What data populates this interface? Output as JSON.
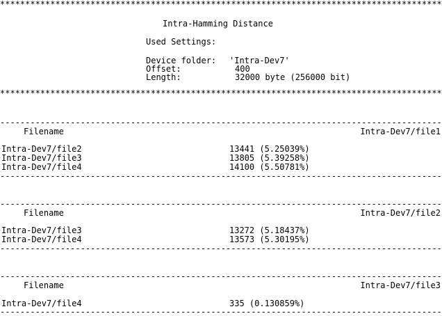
{
  "star_rule": "*********************************************************************************************",
  "dash_rule": "-----------------------------------------------------------------------------------------------",
  "title": "Intra-Hamming Distance",
  "settings": {
    "heading": "Used Settings:",
    "device_folder_label": "Device folder:",
    "device_folder_value": "'Intra-Dev7'",
    "offset_label": "Offset:",
    "offset_value": "400",
    "length_label": "Length:",
    "length_value": "32000 byte (256000 bit)"
  },
  "tables": [
    {
      "col_label": "Filename",
      "reference": "Intra-Dev7/file1",
      "rows": [
        {
          "file": "Intra-Dev7/file2",
          "value": "13441 (5.25039%)"
        },
        {
          "file": "Intra-Dev7/file3",
          "value": "13805 (5.39258%)"
        },
        {
          "file": "Intra-Dev7/file4",
          "value": "14100 (5.50781%)"
        }
      ]
    },
    {
      "col_label": "Filename",
      "reference": "Intra-Dev7/file2",
      "rows": [
        {
          "file": "Intra-Dev7/file3",
          "value": "13272 (5.18437%)"
        },
        {
          "file": "Intra-Dev7/file4",
          "value": "13573 (5.30195%)"
        }
      ]
    },
    {
      "col_label": "Filename",
      "reference": "Intra-Dev7/file3",
      "rows": [
        {
          "file": "Intra-Dev7/file4",
          "value": "335 (0.130859%)"
        }
      ]
    }
  ]
}
